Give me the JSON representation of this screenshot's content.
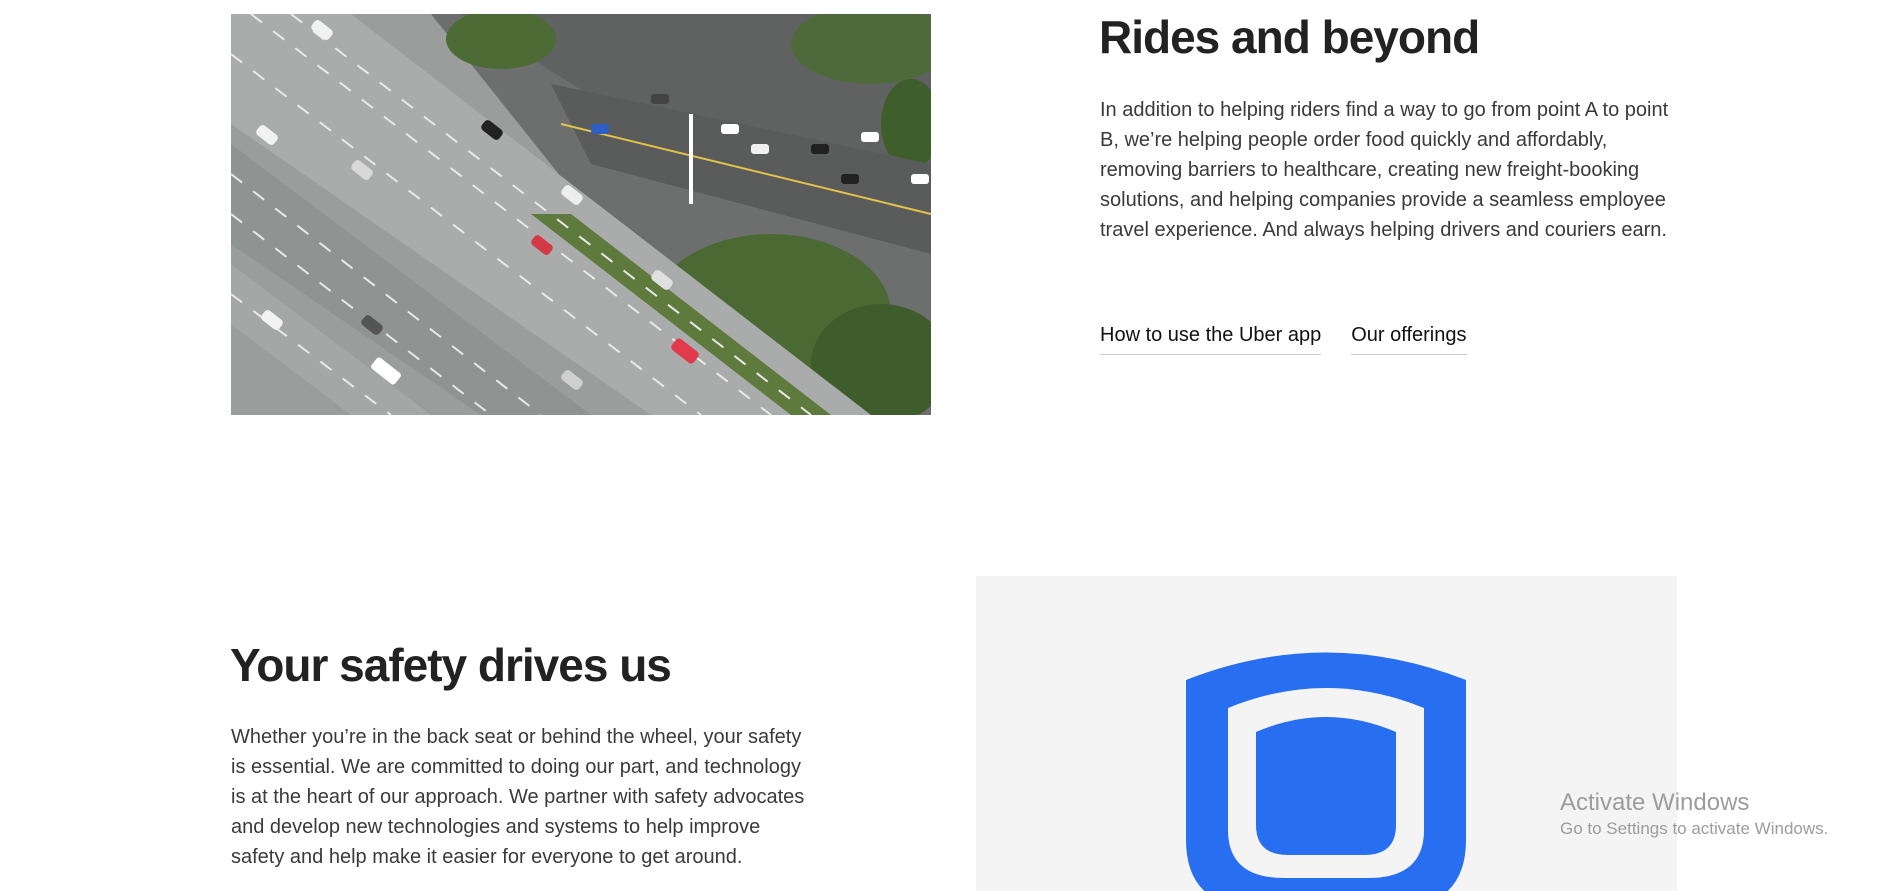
{
  "rides": {
    "title": "Rides and beyond",
    "body": "In addition to helping riders find a way to go from point A to point B, we’re helping people order food quickly and affordably, removing barriers to healthcare, creating new freight-booking solutions, and helping companies provide a seamless employee travel experience. And always helping drivers and couriers earn.",
    "links": {
      "how_to_use": "How to use the Uber app",
      "offerings": "Our offerings"
    }
  },
  "safety": {
    "title": "Your safety drives us",
    "body": "Whether you’re in the back seat or behind the wheel, your safety is essential. We are committed to doing our part, and technology is at the heart of our approach. We partner with safety advocates and develop new technologies and systems to help improve safety and help make it easier for everyone to get around."
  },
  "watermark": {
    "line1": "Activate Windows",
    "line2": "Go to Settings to activate Windows."
  },
  "colors": {
    "shield_blue": "#276EF1",
    "panel_bg": "#F4F4F4"
  },
  "icons": {
    "safety": "shield-icon"
  }
}
